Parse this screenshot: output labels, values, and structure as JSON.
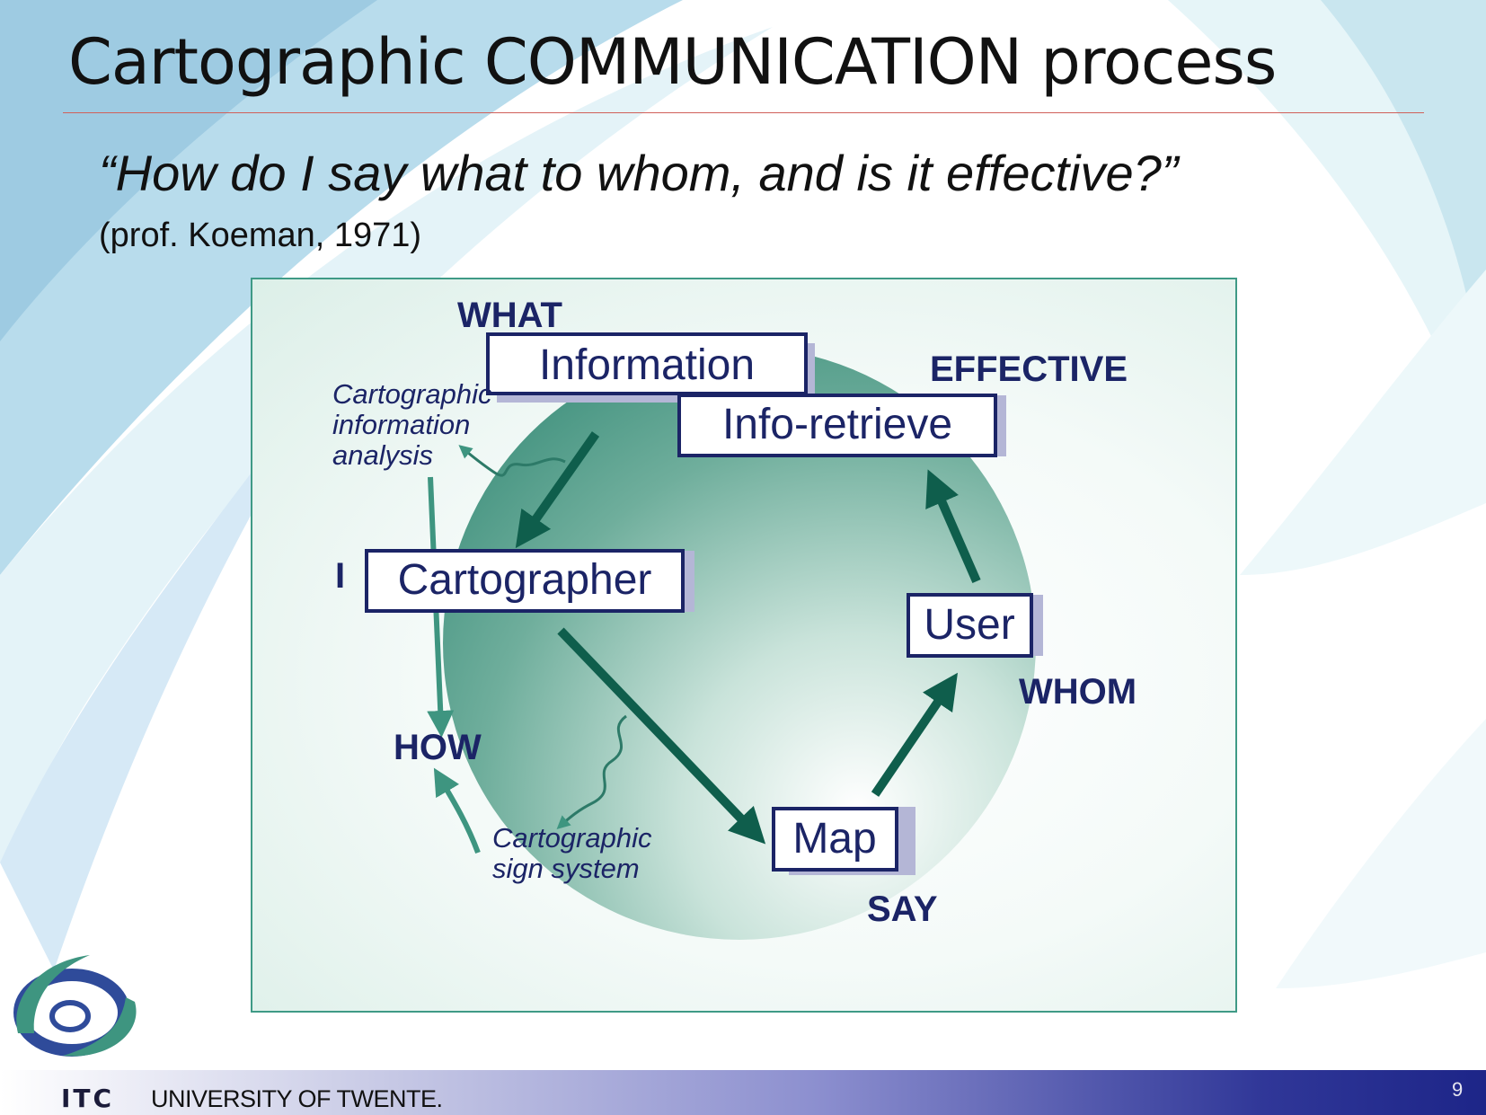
{
  "slide": {
    "title": "Cartographic COMMUNICATION process",
    "quote": "“How do I say what to whom, and is it effective?”",
    "citation": "(prof. Koeman, 1971)",
    "page_number": "9"
  },
  "footer": {
    "institute": "ITC",
    "university": "UNIVERSITY OF TWENTE."
  },
  "diagram": {
    "boxes": {
      "information": "Information",
      "info_retrieve": "Info-retrieve",
      "cartographer": "Cartographer",
      "user": "User",
      "map": "Map"
    },
    "keywords": {
      "what": "WHAT",
      "effective": "EFFECTIVE",
      "i": "I",
      "whom": "WHOM",
      "how": "HOW",
      "say": "SAY"
    },
    "notes": {
      "analysis_line1": "Cartographic",
      "analysis_line2": "information",
      "analysis_line3": "analysis",
      "sign_line1": "Cartographic",
      "sign_line2": "sign system"
    },
    "colors": {
      "navy": "#1b2466",
      "teal_dark": "#0f5e4c",
      "teal_mid": "#3e9580",
      "box_shadow": "#b4b6d6"
    }
  }
}
